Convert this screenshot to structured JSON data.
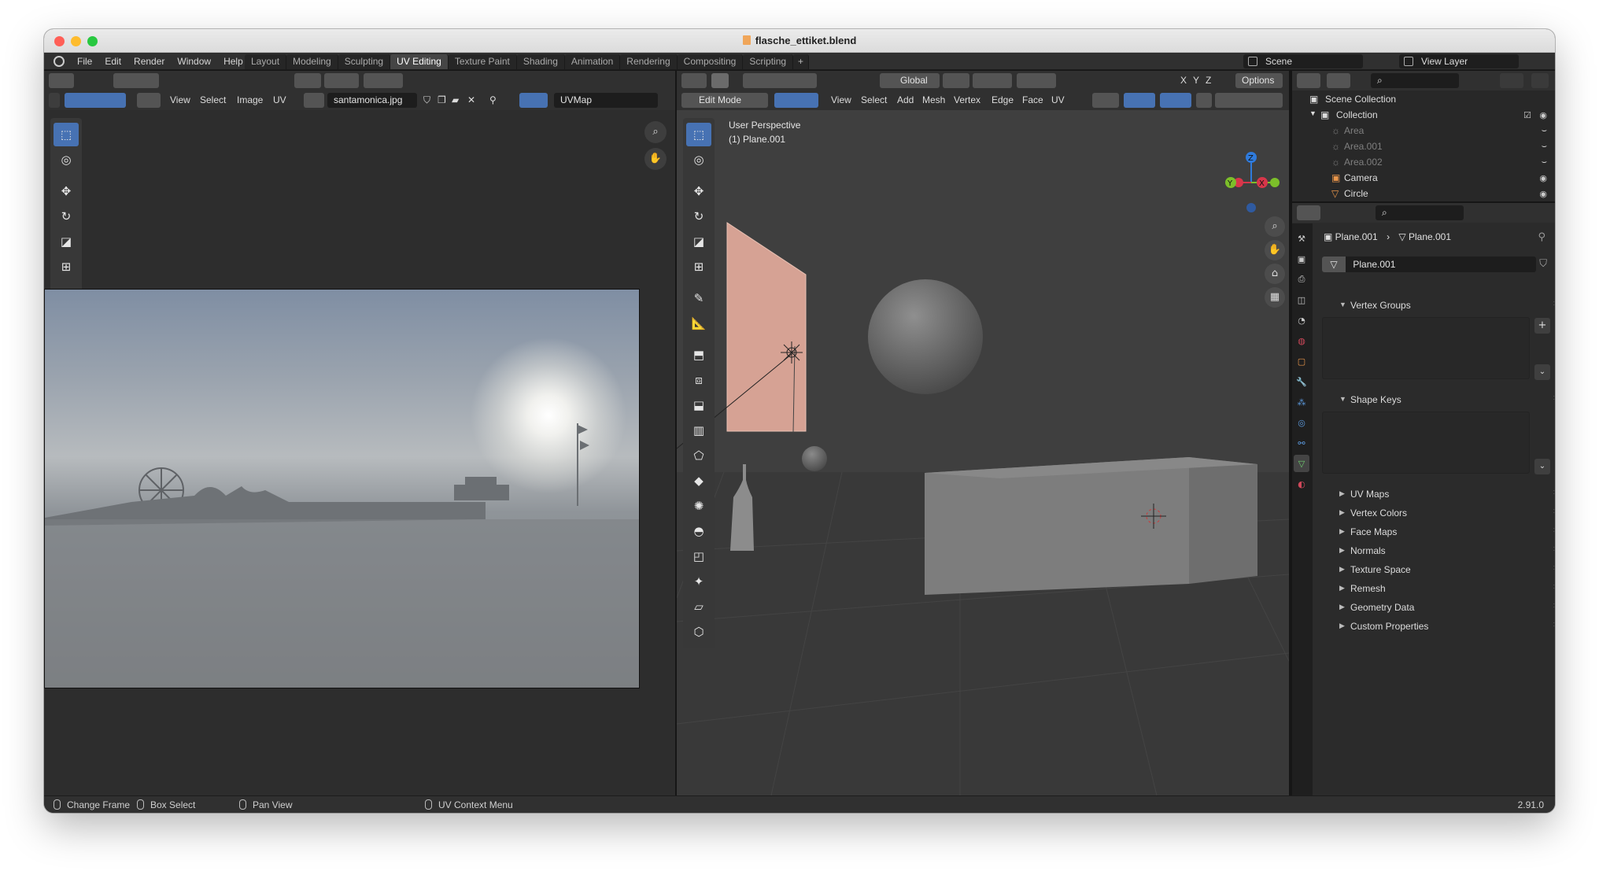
{
  "window": {
    "title": "flasche_ettiket.blend"
  },
  "topmenu": [
    "File",
    "Edit",
    "Render",
    "Window",
    "Help"
  ],
  "workspaces": [
    "Layout",
    "Modeling",
    "Sculpting",
    "UV Editing",
    "Texture Paint",
    "Shading",
    "Animation",
    "Rendering",
    "Compositing",
    "Scripting"
  ],
  "active_workspace": "UV Editing",
  "plus_tab": "+",
  "scene": "Scene",
  "view_layer": "View Layer",
  "uv_editor": {
    "menus": [
      "View",
      "Select",
      "Image",
      "UV"
    ],
    "image_name": "santamonica.jpg",
    "uv_map": "UVMap"
  },
  "viewport": {
    "mode": "Edit Mode",
    "transform": "Global",
    "menus": [
      "View",
      "Select",
      "Add",
      "Mesh",
      "Vertex",
      "Edge",
      "Face",
      "UV"
    ],
    "axes_lock": [
      "X",
      "Y",
      "Z"
    ],
    "options": "Options",
    "overlay_line1": "User Perspective",
    "overlay_line2": "(1) Plane.001",
    "gizmo": {
      "x": "X",
      "y": "Y",
      "z": "Z"
    }
  },
  "outliner": {
    "root": "Scene Collection",
    "collection": "Collection",
    "items": [
      {
        "name": "Area",
        "hidden": true
      },
      {
        "name": "Area.001",
        "hidden": true
      },
      {
        "name": "Area.002",
        "hidden": true
      },
      {
        "name": "Camera",
        "hidden": false
      },
      {
        "name": "Circle",
        "hidden": false
      }
    ]
  },
  "properties": {
    "breadcrumb_object": "Plane.001",
    "breadcrumb_data": "Plane.001",
    "mesh_name": "Plane.001",
    "panels": [
      "Vertex Groups",
      "Shape Keys",
      "UV Maps",
      "Vertex Colors",
      "Face Maps",
      "Normals",
      "Texture Space",
      "Remesh",
      "Geometry Data",
      "Custom Properties"
    ]
  },
  "statusbar": {
    "items": [
      "Change Frame",
      "Box Select",
      "Pan View",
      "UV Context Menu"
    ],
    "version": "2.91.0"
  },
  "colors": {
    "accent": "#4772b3",
    "plane": "#d6a294",
    "panel": "#303030"
  }
}
